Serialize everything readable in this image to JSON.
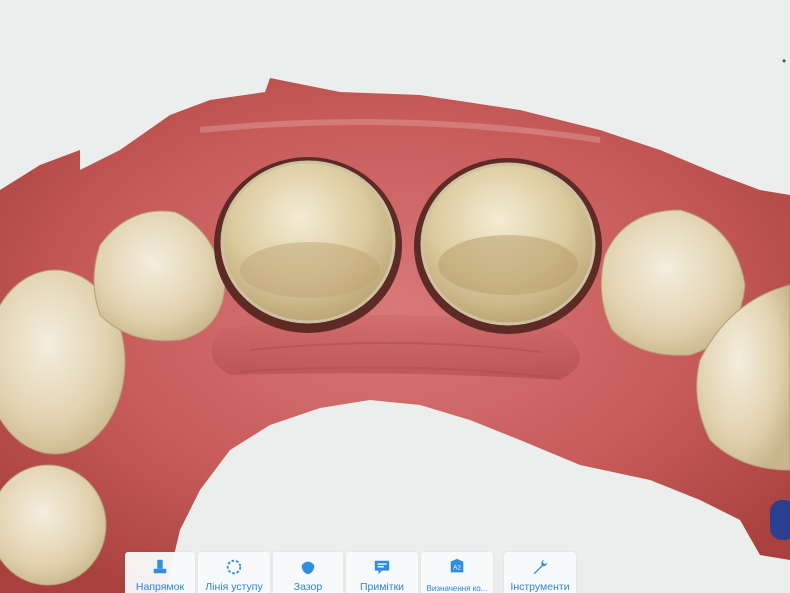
{
  "viewer": {
    "scan": "upper-arch-3d-scan"
  },
  "toolbar": {
    "items": [
      {
        "id": "direction",
        "label": "Напрямок",
        "icon": "direction-icon"
      },
      {
        "id": "margin-line",
        "label": "Лінія уступу",
        "icon": "margin-line-icon"
      },
      {
        "id": "gap",
        "label": "Зазор",
        "icon": "gap-icon"
      },
      {
        "id": "notes",
        "label": "Примітки",
        "icon": "notes-icon"
      },
      {
        "id": "define",
        "label": "Визначення ко...",
        "icon": "define-icon"
      },
      {
        "id": "tools",
        "label": "Інструменти",
        "icon": "wrench-icon"
      }
    ]
  },
  "colors": {
    "accent": "#2f8ede",
    "gum": "#c85a58",
    "tooth": "#e8dcc0",
    "background": "#eceeed"
  }
}
